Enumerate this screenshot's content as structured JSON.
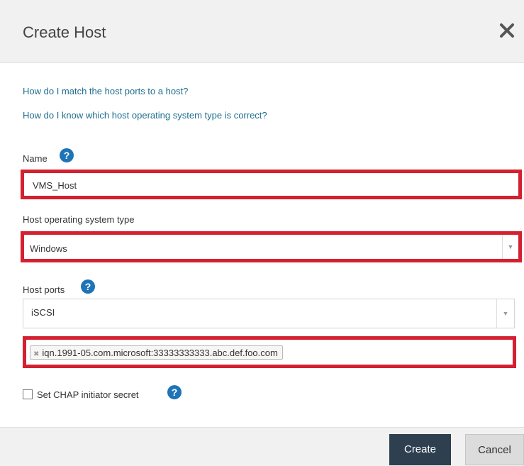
{
  "dialog": {
    "title": "Create Host",
    "close_icon": "close-icon"
  },
  "help_links": [
    "How do I match the host ports to a host?",
    "How do I know which host operating system type is correct?"
  ],
  "name": {
    "label": "Name",
    "value": "VMS_Host",
    "help_icon": "help-icon"
  },
  "os_type": {
    "label": "Host operating system type",
    "selected": "Windows"
  },
  "host_ports": {
    "label": "Host ports",
    "protocol": "iSCSI",
    "ports": [
      "iqn.1991-05.com.microsoft:33333333333.abc.def.foo.com"
    ]
  },
  "chap": {
    "label": "Set CHAP initiator secret",
    "checked": false
  },
  "footer": {
    "create_label": "Create",
    "cancel_label": "Cancel"
  },
  "colors": {
    "highlight": "#d42030",
    "link": "#1f6e8f",
    "help_icon": "#1e74b6",
    "primary_button": "#2e3f4f"
  }
}
